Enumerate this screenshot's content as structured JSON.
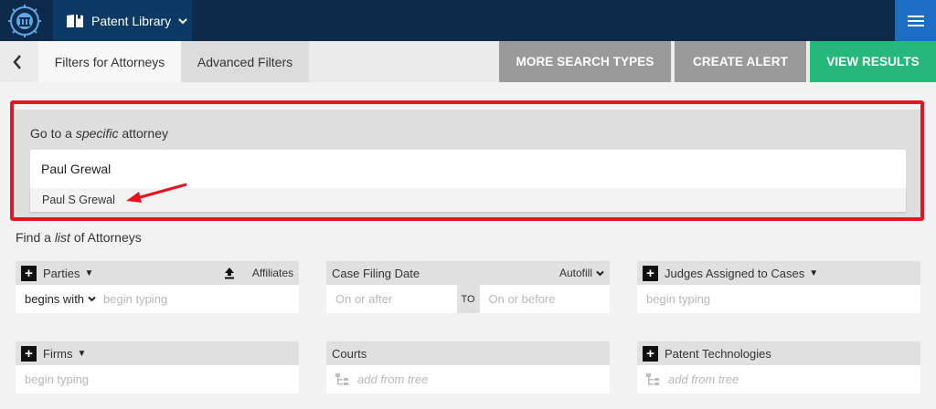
{
  "nav": {
    "library_label": "Patent Library"
  },
  "tabs": {
    "active": "Filters for Attorneys",
    "advanced": "Advanced Filters"
  },
  "actions": {
    "more": "MORE SEARCH TYPES",
    "alert": "CREATE ALERT",
    "view": "VIEW RESULTS"
  },
  "specific": {
    "label_pre": "Go to a ",
    "label_em": "specific",
    "label_post": " attorney",
    "input_value": "Paul Grewal",
    "suggestion": "Paul S Grewal"
  },
  "list": {
    "label_pre": "Find a ",
    "label_em": "list",
    "label_post": " of Attorneys"
  },
  "filters": {
    "parties": {
      "title": "Parties",
      "affiliates": "Affiliates",
      "mode": "begins with",
      "placeholder": "begin typing"
    },
    "case_filing": {
      "title": "Case Filing Date",
      "autofill": "Autofill",
      "from_placeholder": "On or after",
      "to_label": "TO",
      "to_placeholder": "On or before"
    },
    "judges": {
      "title": "Judges Assigned to Cases",
      "placeholder": "begin typing"
    },
    "firms": {
      "title": "Firms",
      "placeholder": "begin typing"
    },
    "courts": {
      "title": "Courts",
      "placeholder": "add from tree"
    },
    "technologies": {
      "title": "Patent Technologies",
      "placeholder": "add from tree"
    }
  },
  "colors": {
    "nav": "#0e2a4a",
    "view_results": "#24b87a",
    "highlight": "#e8141d",
    "menu_button": "#1e6dc4"
  }
}
